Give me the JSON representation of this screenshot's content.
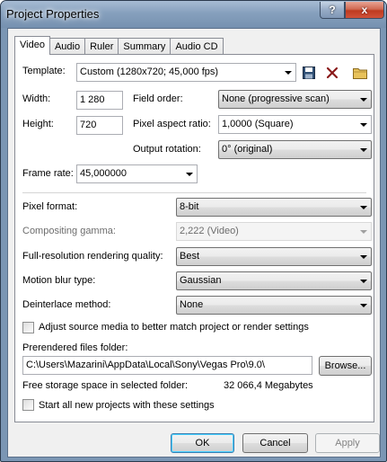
{
  "window": {
    "title": "Project Properties",
    "help_glyph": "?",
    "close_glyph": "x"
  },
  "tabs": [
    "Video",
    "Audio",
    "Ruler",
    "Summary",
    "Audio CD"
  ],
  "active_tab": "Video",
  "video": {
    "template": {
      "label": "Template:",
      "value": "Custom (1280x720; 45,000 fps)"
    },
    "template_icons": [
      "save-icon",
      "delete-icon",
      "folder-icon"
    ],
    "width": {
      "label": "Width:",
      "value": "1 280"
    },
    "height": {
      "label": "Height:",
      "value": "720"
    },
    "field_order": {
      "label": "Field order:",
      "value": "None (progressive scan)"
    },
    "pixel_aspect_ratio": {
      "label": "Pixel aspect ratio:",
      "value": "1,0000 (Square)"
    },
    "output_rotation": {
      "label": "Output rotation:",
      "value": "0° (original)"
    },
    "frame_rate": {
      "label": "Frame rate:",
      "value": "45,000000"
    },
    "pixel_format": {
      "label": "Pixel format:",
      "value": "8-bit"
    },
    "compositing_gamma": {
      "label": "Compositing gamma:",
      "value": "2,222 (Video)"
    },
    "rendering_quality": {
      "label": "Full-resolution rendering quality:",
      "value": "Best"
    },
    "motion_blur": {
      "label": "Motion blur type:",
      "value": "Gaussian"
    },
    "deinterlace": {
      "label": "Deinterlace method:",
      "value": "None"
    },
    "adjust_source": {
      "label": "Adjust source media to better match project or render settings",
      "checked": false
    },
    "prerendered_folder": {
      "label": "Prerendered files folder:",
      "value": "C:\\Users\\Mazarini\\AppData\\Local\\Sony\\Vegas Pro\\9.0\\"
    },
    "browse_label": "Browse...",
    "free_space": {
      "label": "Free storage space in selected folder:",
      "value": "32 066,4 Megabytes"
    },
    "start_new": {
      "label": "Start all new projects with these settings",
      "checked": false
    }
  },
  "buttons": {
    "ok": "OK",
    "cancel": "Cancel",
    "apply": "Apply"
  },
  "colors": {
    "title_bar": "#86a0bd",
    "close_button": "#c94a30",
    "default_button_border": "#3c7fb1"
  }
}
